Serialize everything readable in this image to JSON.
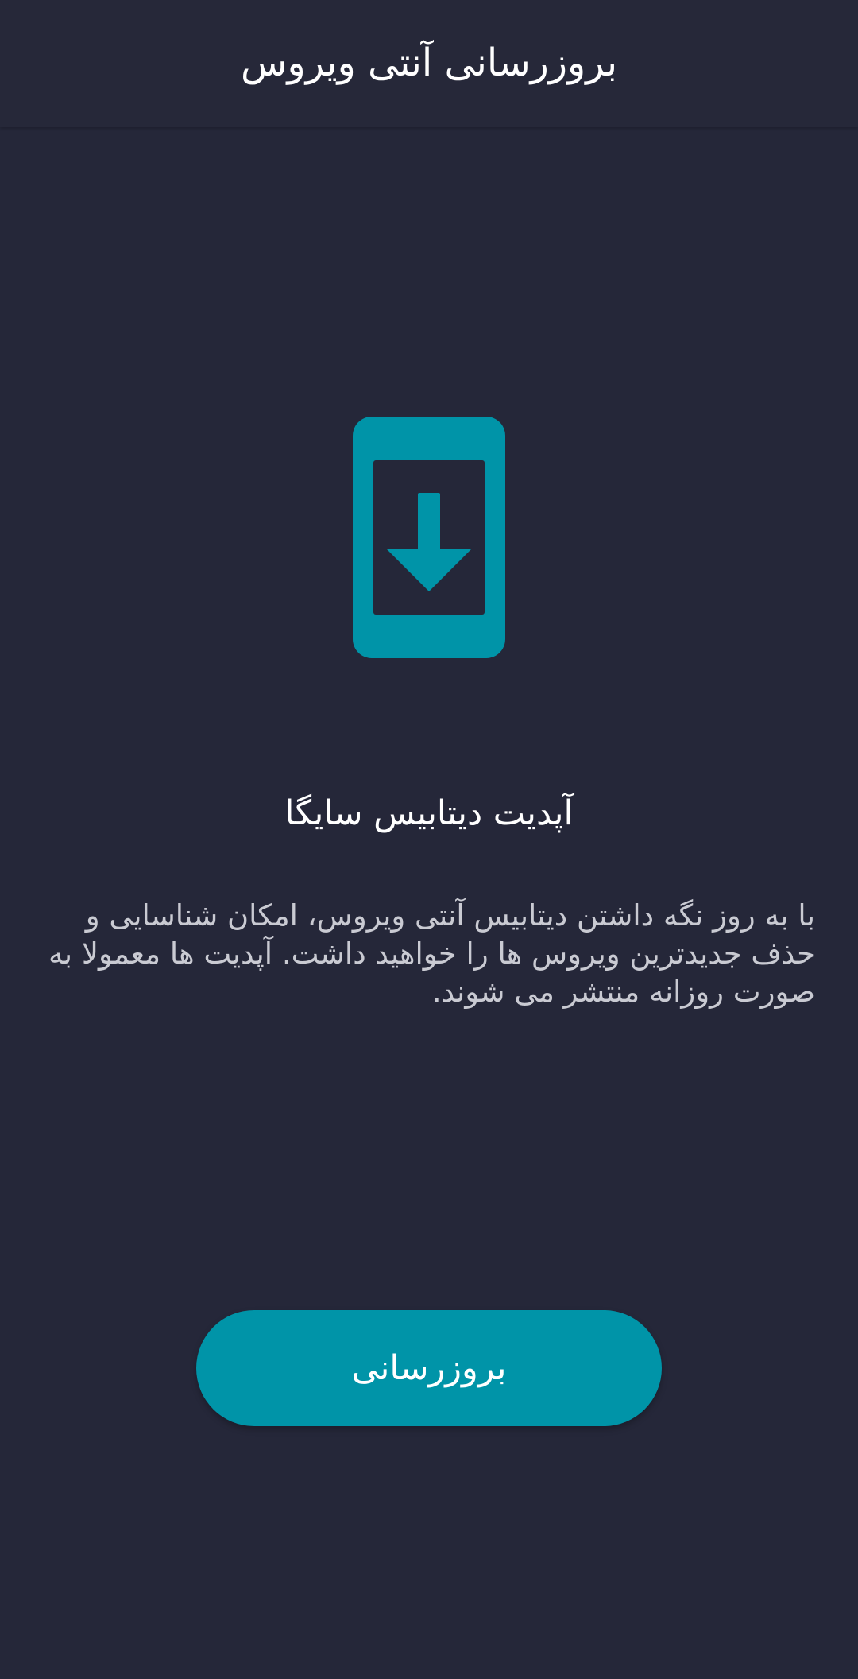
{
  "app_bar": {
    "title": "بروزرسانی آنتی ویروس"
  },
  "illustration": {
    "icon": "phone-download-icon",
    "color": "#0094a8"
  },
  "content": {
    "title": "آپدیت دیتابیس سایگا",
    "description": "با به روز نگه داشتن دیتابیس آنتی ویروس، امکان شناسایی و حذف جدیدترین ویروس ها را خواهید داشت. آپدیت ها معمولا به صورت روزانه منتشر می شوند."
  },
  "actions": {
    "update_label": "بروزرسانی"
  },
  "colors": {
    "background": "#252739",
    "accent": "#0094a8",
    "text_primary": "#ffffff",
    "text_secondary": "#c9cad2"
  }
}
